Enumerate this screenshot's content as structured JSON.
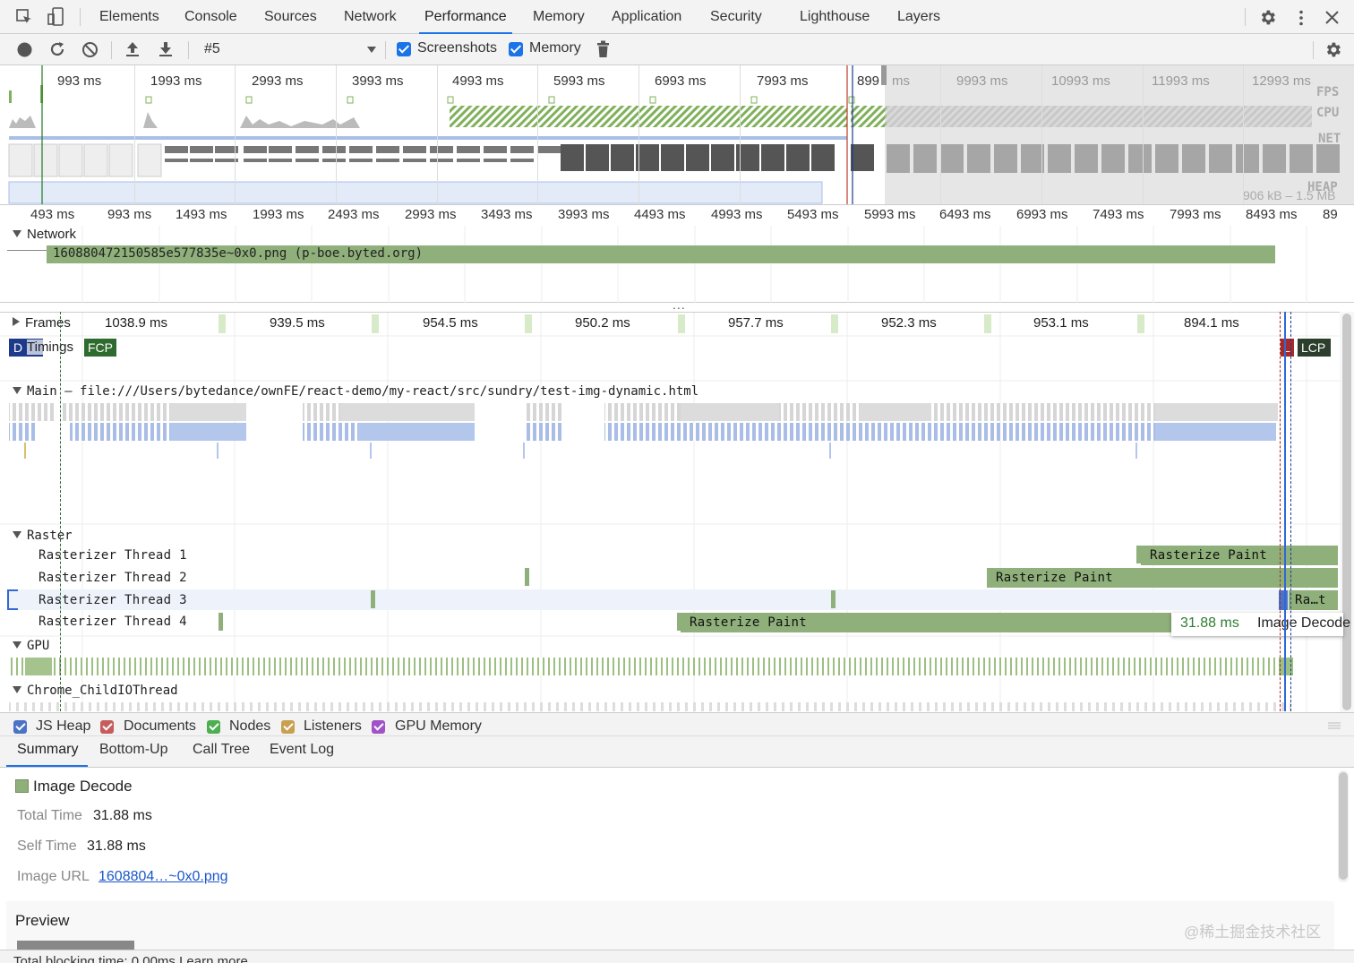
{
  "tabs": [
    "Elements",
    "Console",
    "Sources",
    "Network",
    "Performance",
    "Memory",
    "Application",
    "Security",
    "Lighthouse",
    "Layers"
  ],
  "active_tab": "Performance",
  "toolbar": {
    "profile_select": "#5",
    "screenshots_label": "Screenshots",
    "memory_label": "Memory"
  },
  "overview": {
    "ticks": [
      "993 ms",
      "1993 ms",
      "2993 ms",
      "3993 ms",
      "4993 ms",
      "5993 ms",
      "6993 ms",
      "7993 ms",
      "899",
      "ms",
      "9993 ms",
      "10993 ms",
      "11993 ms",
      "12993 ms"
    ],
    "tracks": [
      "FPS",
      "CPU",
      "NET",
      "HEAP"
    ],
    "heap_range": "906 kB – 1.5 MB"
  },
  "ruler_ticks": [
    "493 ms",
    "993 ms",
    "1493 ms",
    "1993 ms",
    "2493 ms",
    "2993 ms",
    "3493 ms",
    "3993 ms",
    "4493 ms",
    "4993 ms",
    "5493 ms",
    "5993 ms",
    "6493 ms",
    "6993 ms",
    "7493 ms",
    "7993 ms",
    "8493 ms",
    "89"
  ],
  "network": {
    "label": "Network",
    "request": "160880472150585e577835e~0x0.png (p-boe.byted.org)"
  },
  "frames": {
    "label": "Frames",
    "durations": [
      "1038.9 ms",
      "939.5 ms",
      "954.5 ms",
      "950.2 ms",
      "957.7 ms",
      "952.3 ms",
      "953.1 ms",
      "894.1 ms"
    ]
  },
  "timings": {
    "label": "Timings",
    "fcp": "FCP",
    "l": "L",
    "lcp": "LCP",
    "dcl": "D"
  },
  "main": {
    "label": "Main",
    "url": "— file:///Users/bytedance/ownFE/react-demo/my-react/src/sundry/test-img-dynamic.html"
  },
  "raster": {
    "label": "Raster",
    "threads": [
      "Rasterizer Thread 1",
      "Rasterizer Thread 2",
      "Rasterizer Thread 3",
      "Rasterizer Thread 4"
    ],
    "events": [
      "Rasterize Paint",
      "Rasterize Paint",
      "Ra…t",
      "Rasterize Paint"
    ]
  },
  "tooltip": {
    "time": "31.88 ms",
    "name": "Image Decode"
  },
  "gpu_label": "GPU",
  "childio_label": "Chrome_ChildIOThread",
  "memory_checkboxes": [
    {
      "label": "JS Heap",
      "color": "#4a73c8"
    },
    {
      "label": "Documents",
      "color": "#c75c5c"
    },
    {
      "label": "Nodes",
      "color": "#4caf50"
    },
    {
      "label": "Listeners",
      "color": "#c8a050"
    },
    {
      "label": "GPU Memory",
      "color": "#a052c8"
    }
  ],
  "bottom_tabs": [
    "Summary",
    "Bottom-Up",
    "Call Tree",
    "Event Log"
  ],
  "summary": {
    "title": "Image Decode",
    "swatch_color": "#8fb07a",
    "total_time_label": "Total Time",
    "total_time": "31.88 ms",
    "self_time_label": "Self Time",
    "self_time": "31.88 ms",
    "image_url_label": "Image URL",
    "image_url": "1608804…~0x0.png"
  },
  "preview": {
    "label": "Preview",
    "blocking": "Total blocking time: 0.00ms Learn more"
  },
  "watermark": "@稀土掘金技术社区"
}
